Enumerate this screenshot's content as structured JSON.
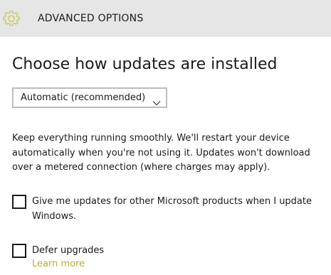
{
  "header": {
    "icon": "gear-icon",
    "icon_color": "#c8c84a",
    "title": "ADVANCED OPTIONS"
  },
  "main": {
    "heading": "Choose how updates are installed",
    "install_mode": {
      "selected": "Automatic (recommended)",
      "icon": "chevron-down-icon"
    },
    "description": "Keep everything running smoothly. We'll restart your device automatically when you're not using it. Updates won't download over a metered connection (where charges may apply).",
    "options": [
      {
        "label": "Give me updates for other Microsoft products when I update Windows.",
        "checked": false
      },
      {
        "label": "Defer upgrades",
        "checked": false
      }
    ],
    "learn_more": "Learn more",
    "accent_color": "#b5b32a"
  }
}
